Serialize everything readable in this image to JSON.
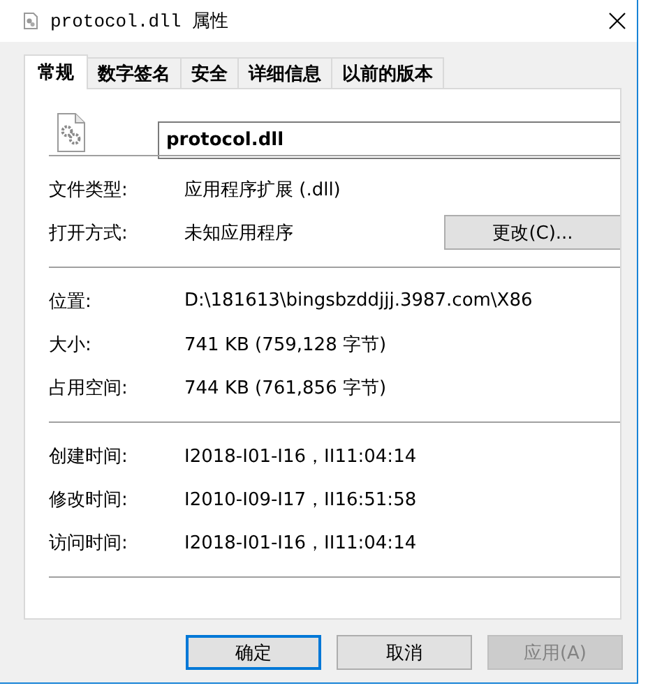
{
  "window": {
    "title": "protocol.dll 属性"
  },
  "tabs": [
    {
      "label": "常规",
      "selected": true
    },
    {
      "label": "数字签名",
      "selected": false
    },
    {
      "label": "安全",
      "selected": false
    },
    {
      "label": "详细信息",
      "selected": false
    },
    {
      "label": "以前的版本",
      "selected": false
    }
  ],
  "file": {
    "name": "protocol.dll"
  },
  "groups": [
    [
      {
        "label": "文件类型:",
        "value": "应用程序扩展 (.dll)"
      },
      {
        "label": "打开方式:",
        "value": "未知应用程序",
        "button": "更改(C)..."
      }
    ],
    [
      {
        "label": "位置:",
        "value": "D:\\181613\\bingsbzddjjj.3987.com\\X86"
      },
      {
        "label": "大小:",
        "value": "741 KB (759,128 字节)"
      },
      {
        "label": "占用空间:",
        "value": "744 KB (761,856 字节)"
      }
    ],
    [
      {
        "label": "创建时间:",
        "value": "I2018-I01-I16，II11:04:14"
      },
      {
        "label": "修改时间:",
        "value": "I2010-I09-I17，II16:51:58"
      },
      {
        "label": "访问时间:",
        "value": "I2018-I01-I16，II11:04:14"
      }
    ]
  ],
  "buttons": [
    {
      "label": "确定",
      "kind": "default",
      "disabled": false
    },
    {
      "label": "取消",
      "kind": "normal",
      "disabled": false
    },
    {
      "label": "应用(A)",
      "kind": "normal",
      "disabled": true
    }
  ]
}
